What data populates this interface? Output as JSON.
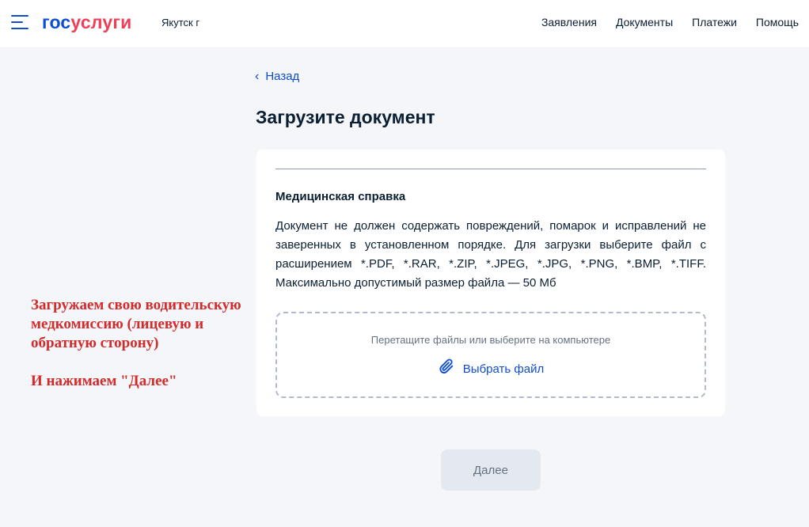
{
  "header": {
    "logo_part1": "гос",
    "logo_part2": "услуги",
    "city": "Якутск г",
    "nav": [
      "Заявления",
      "Документы",
      "Платежи",
      "Помощь"
    ]
  },
  "page": {
    "back_label": "Назад",
    "title": "Загрузите документ"
  },
  "card": {
    "doc_title": "Медицинская справка",
    "doc_description": "Документ не должен содержать повреждений, помарок и исправлений не заверенных в установленном порядке. Для загрузки выберите файл с расширением *.PDF, *.RAR, *.ZIP, *.JPEG, *.JPG, *.PNG, *.BMP, *.TIFF. Максимально допустимый размер файла — 50 Мб",
    "dropzone_hint": "Перетащите файлы или выберите на компьютере",
    "choose_file_label": "Выбрать файл"
  },
  "annotation": {
    "line1": "Загружаем свою водительскую медкомиссию (лицевую и обратную сторону)",
    "line2": "И нажимаем \"Далее\""
  },
  "footer": {
    "next_label": "Далее"
  },
  "colors": {
    "accent": "#0d4cd3",
    "brand_red": "#ee3f58",
    "annotation_red": "#d32a2a",
    "button_disabled_bg": "#e4e9f0"
  }
}
